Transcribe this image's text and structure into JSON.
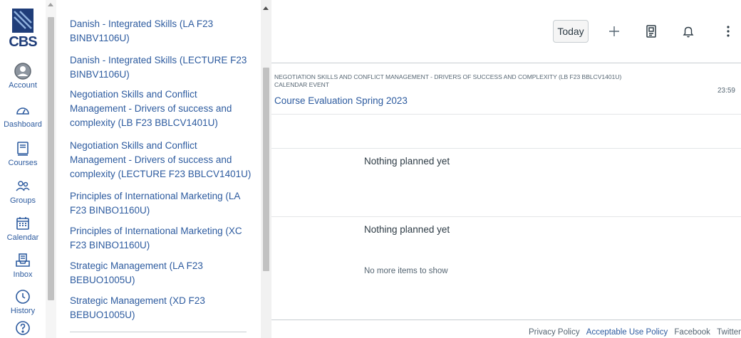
{
  "global_nav": {
    "logo_text": "CBS",
    "items": [
      {
        "label": "Account",
        "icon": "account-icon"
      },
      {
        "label": "Dashboard",
        "icon": "dashboard-icon"
      },
      {
        "label": "Courses",
        "icon": "courses-icon"
      },
      {
        "label": "Groups",
        "icon": "groups-icon"
      },
      {
        "label": "Calendar",
        "icon": "calendar-icon"
      },
      {
        "label": "Inbox",
        "icon": "inbox-icon"
      },
      {
        "label": "History",
        "icon": "history-icon"
      },
      {
        "label": "",
        "icon": "help-icon"
      }
    ]
  },
  "tray": {
    "courses": [
      "Danish - Integrated Skills (LA F23 BINBV1106U)",
      "Danish - Integrated Skills (LECTURE F23 BINBV1106U)",
      "Negotiation Skills and Conflict Management - Drivers of success and complexity (LB F23 BBLCV1401U)",
      "Negotiation Skills and Conflict Management - Drivers of success and complexity (LECTURE F23 BBLCV1401U)",
      "Principles of International Marketing (LA F23 BINBO1160U)",
      "Principles of International Marketing (XC F23 BINBO1160U)",
      "Strategic Management (LA F23 BEBUO1005U)",
      "Strategic Management (XD F23 BEBUO1005U)"
    ]
  },
  "toolbar": {
    "today_label": "Today",
    "icons": [
      "plus-icon",
      "grades-icon",
      "bell-icon",
      "more-icon"
    ]
  },
  "planner": {
    "event": {
      "meta": "NEGOTIATION SKILLS AND CONFLICT MANAGEMENT - DRIVERS OF SUCCESS AND COMPLEXITY (LB F23 BBLCV1401U) CALENDAR EVENT",
      "title": "Course Evaluation Spring 2023",
      "time": "23:59"
    },
    "empty_1": "Nothing planned yet",
    "empty_2": "Nothing planned yet",
    "no_more": "No more items to show"
  },
  "footer": {
    "privacy": "Privacy Policy",
    "acceptable": "Acceptable Use Policy",
    "facebook": "Facebook",
    "twitter": "Twitter"
  }
}
